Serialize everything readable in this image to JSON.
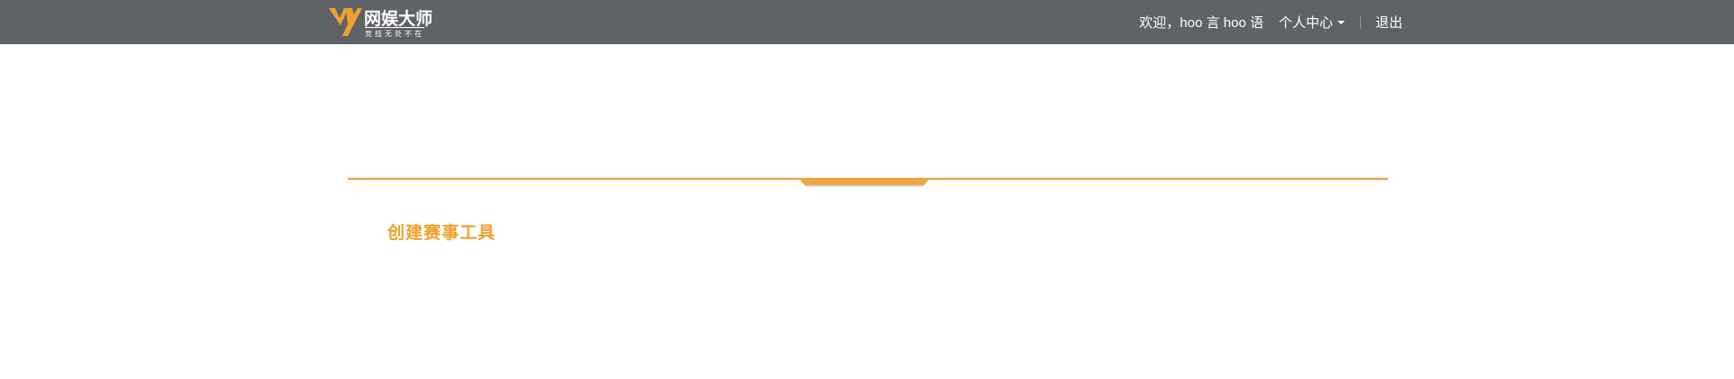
{
  "brand": {
    "name": "网娱大师",
    "slogan": "竞技无处不在",
    "mark_color": "#f0a02e"
  },
  "header": {
    "welcome": "欢迎，hoo 言 hoo 语",
    "personal_center": "个人中心",
    "logout": "退出",
    "background_color": "#5f6266"
  },
  "main": {
    "section_title": "创建赛事工具",
    "accent_color": "#f0a63a"
  }
}
